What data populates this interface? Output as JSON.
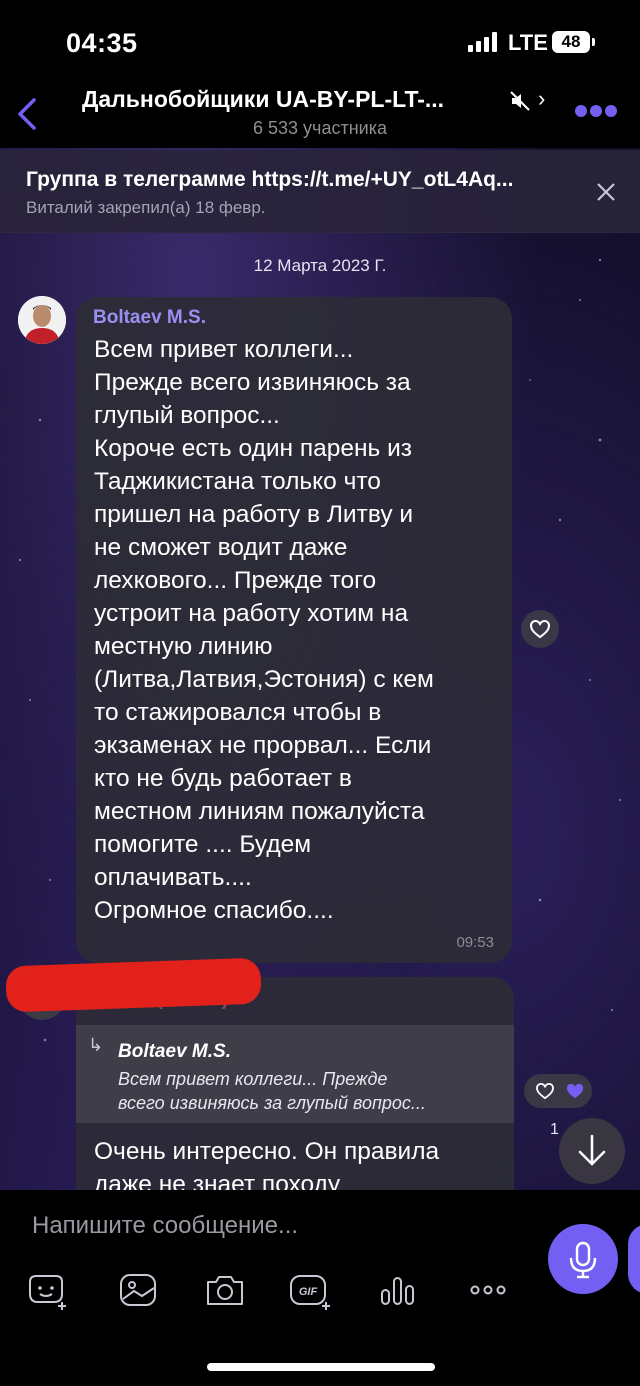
{
  "status": {
    "time": "04:35",
    "network": "LTE",
    "battery": "48"
  },
  "header": {
    "title": "Дальнобойщики UA-BY-PL-LT-...",
    "members": "6 533 участника"
  },
  "pinned": {
    "text": "Группа в телеграмме https://t.me/+UY_otL4Aq...",
    "subtitle": "Виталий  закрепил(а) 18 февр."
  },
  "date_divider": "12 Марта 2023 Г.",
  "messages": [
    {
      "sender": "Boltaev M.S.",
      "text": "Всем привет коллеги...\nПрежде всего извиняюсь за\nглупый вопрос...\nКороче есть один парень из\nТаджикистана только что\nпришел на работу в Литву и\nне сможет водит даже\nлехкового... Прежде того\nустроит на работу хотим на\nместную линию\n(Литва,Латвия,Эстония) с кем\nто стажировался чтобы в\nэкзаменах не прорвал... Если\nкто не будь работает в\nместном линиям пожалуйста\nпомогите .... Будем\nоплачивать....\nОгромное спасибо....",
      "time": "09:53"
    },
    {
      "sender": "Денис (малон)",
      "reply_to": {
        "name": "Boltaev M.S.",
        "text": "Всем привет коллеги... Прежде\nвсего извиняюсь за глупый вопрос..."
      },
      "text": "Очень интересно. Он правила\nдаже не знает походу",
      "reaction_count": "1"
    }
  ],
  "composer": {
    "placeholder": "Напишите сообщение..."
  },
  "colors": {
    "accent": "#7360f2",
    "sender_name": "#9b8ff3",
    "bubble": "#2d2c36"
  }
}
